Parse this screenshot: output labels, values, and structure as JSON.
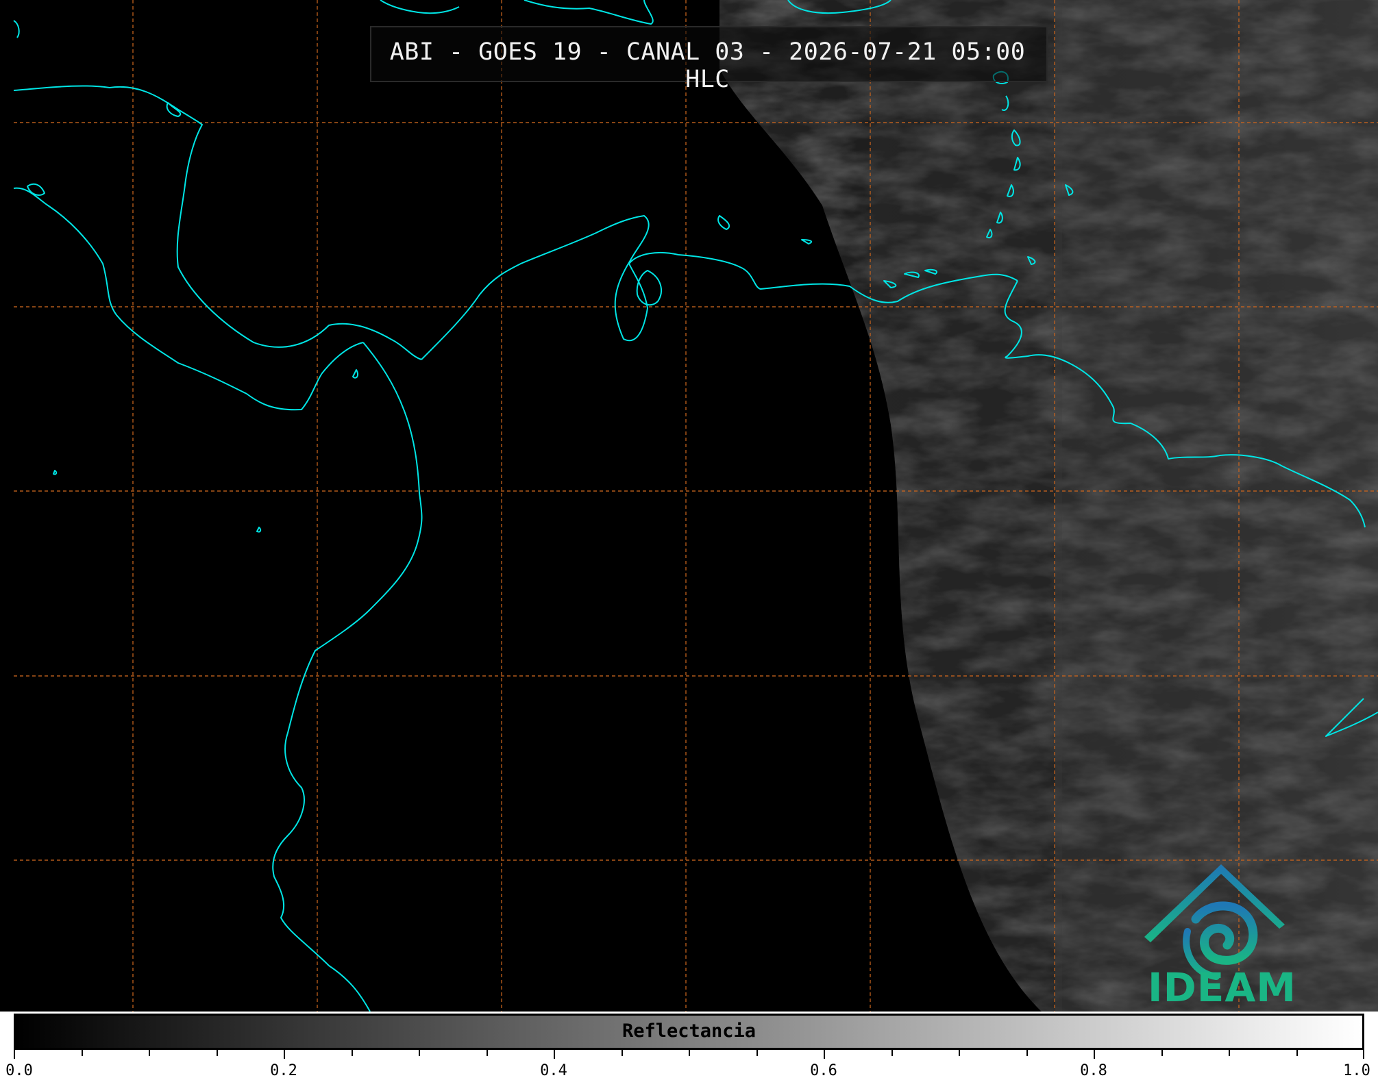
{
  "title": "ABI - GOES 19 - CANAL 03 - 2026-07-21 05:00 HLC",
  "logo": {
    "text": "IDEAM"
  },
  "colorbar": {
    "label": "Reflectancia",
    "min": 0.0,
    "max": 1.0,
    "gradient": [
      "#000000",
      "#ffffff"
    ],
    "tick_labels": [
      "0.0",
      "0.2",
      "0.4",
      "0.6",
      "0.8",
      "1.0"
    ]
  },
  "colors": {
    "coastline": "#00e5e5",
    "graticule": "#c8641e",
    "background": "#000000",
    "logo_blue": "#1f8ab5",
    "logo_green": "#1ab585"
  }
}
